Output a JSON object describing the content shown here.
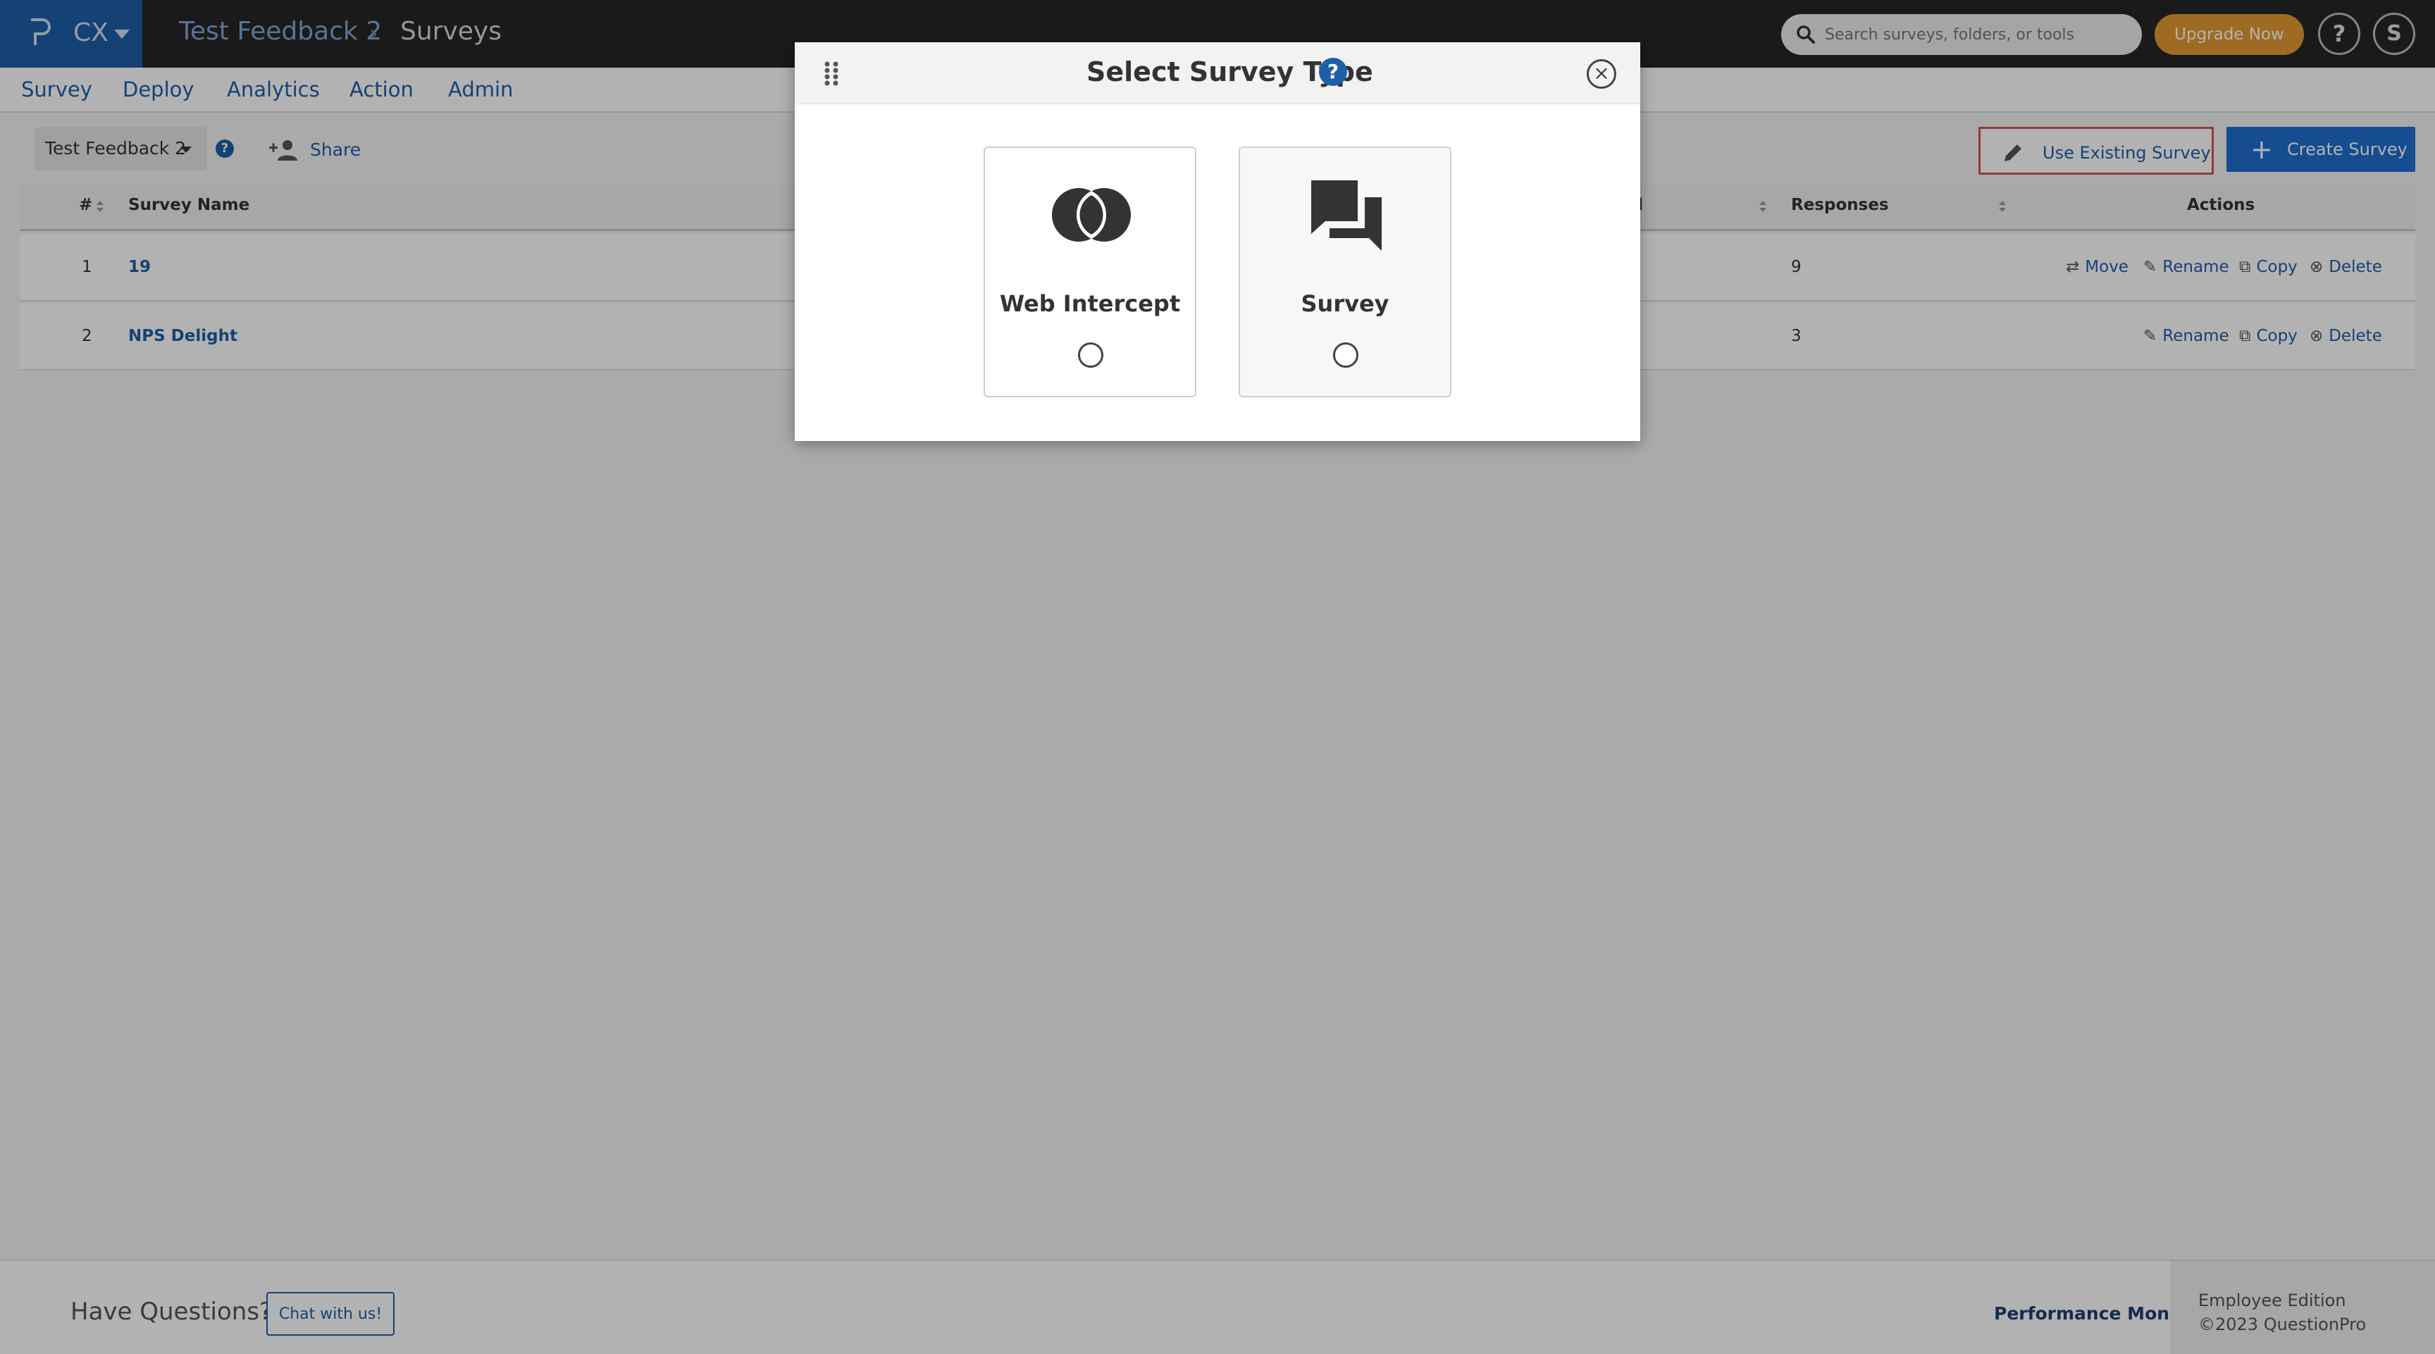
{
  "app": {
    "brand_name": "CX",
    "breadcrumb": [
      "Test Feedback 2",
      "Surveys"
    ],
    "breadcrumb_separator": "›"
  },
  "search": {
    "placeholder": "Search surveys, folders, or tools"
  },
  "header": {
    "upgrade_label": "Upgrade Now",
    "help_label": "?",
    "avatar_initial": "S"
  },
  "nav": {
    "items": [
      "Survey",
      "Deploy",
      "Analytics",
      "Action",
      "Admin"
    ]
  },
  "toolbar": {
    "folder_selected": "Test Feedback 2",
    "help_label": "?",
    "share_label": "Share",
    "use_existing_label": "Use Existing Survey",
    "create_label": "Create Survey",
    "create_icon": "+"
  },
  "table": {
    "columns": [
      "#",
      "Survey Name",
      "ed",
      "Responses",
      "Actions"
    ],
    "rows": [
      {
        "num": "1",
        "name": "19",
        "responses": "9",
        "actions": [
          "Move",
          "Rename",
          "Copy",
          "Delete"
        ]
      },
      {
        "num": "2",
        "name": "NPS Delight",
        "responses": "3",
        "actions": [
          "Rename",
          "Copy",
          "Delete"
        ]
      }
    ]
  },
  "footer": {
    "questions": "Have Questions?",
    "chat_label": "Chat with us!",
    "perf_monitor": "Performance Monitor",
    "edition": "Employee Edition",
    "copyright": "©2023 QuestionPro"
  },
  "modal": {
    "title": "Select Survey Type",
    "help_label": "?",
    "close_label": "×",
    "options": [
      {
        "label": "Web Intercept",
        "icon": "web-intercept-icon"
      },
      {
        "label": "Survey",
        "icon": "chat-bubbles-icon"
      }
    ]
  },
  "colors": {
    "brand": "#1f5fa8",
    "upgrade": "#e39a33",
    "danger_outline": "#d9534f",
    "topbar": "#262626"
  }
}
